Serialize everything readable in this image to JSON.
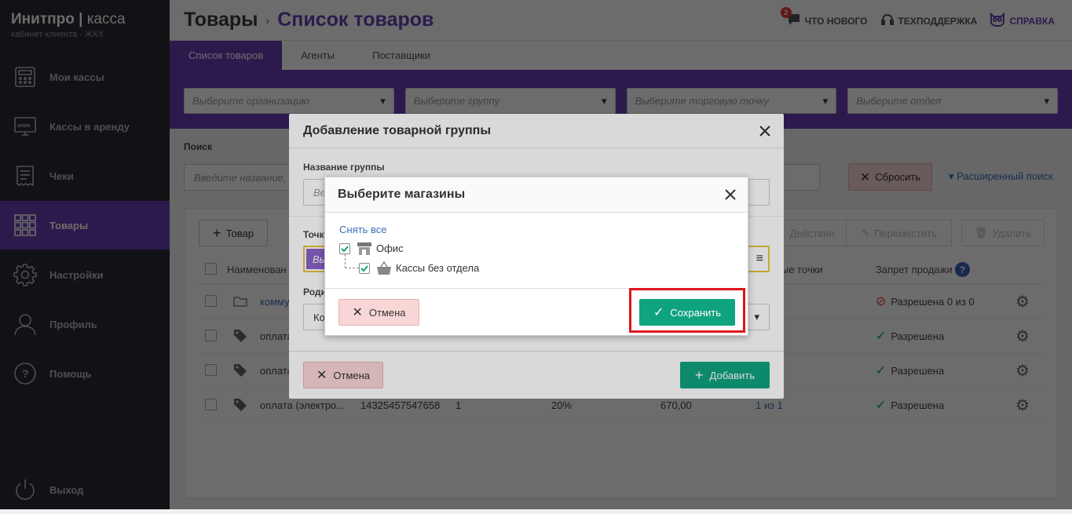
{
  "brand": {
    "title": "Инитпро",
    "title2": "касса",
    "subtitle": "кабинет клиента - ЖКХ"
  },
  "sidebar": {
    "items": [
      {
        "label": "Мои кассы"
      },
      {
        "label": "Кассы в аренду"
      },
      {
        "label": "Чеки"
      },
      {
        "label": "Товары"
      },
      {
        "label": "Настройки"
      },
      {
        "label": "Профиль"
      },
      {
        "label": "Помощь"
      }
    ],
    "logout": "Выход"
  },
  "header": {
    "crumb1": "Товары",
    "crumb2": "Список товаров",
    "badge": "2",
    "whats_new": "ЧТО НОВОГО",
    "support": "ТЕХПОДДЕРЖКА",
    "help": "СПРАВКА"
  },
  "tabs": [
    "Список товаров",
    "Агенты",
    "Поставщики"
  ],
  "filters": [
    "Выберите организацию",
    "Выберите группу",
    "Выберите торговую точку",
    "Выберите отдел"
  ],
  "search": {
    "label": "Поиск",
    "placeholder": "Введите название, ",
    "reset": "Сбросить",
    "advanced": "Расширенный поиск"
  },
  "toolbar": {
    "add_item": "Товар",
    "actions": "Действия",
    "move": "Переместить",
    "delete": "Удалить"
  },
  "table": {
    "headers": {
      "name": "Наименован",
      "points": "ые точки",
      "ban": "Запрет продажи"
    },
    "rows": [
      {
        "name": "комму",
        "barcode": "",
        "qty": "",
        "vat": "",
        "price": "",
        "points": "",
        "status": "Разрешена 0 из 0"
      },
      {
        "name": "оплата",
        "barcode": "",
        "qty": "",
        "vat": "",
        "price": "",
        "points": "",
        "status": "Разрешена"
      },
      {
        "name": "оплата",
        "barcode": "",
        "qty": "",
        "vat": "",
        "price": "",
        "points": "",
        "status": "Разрешена"
      },
      {
        "name": "оплата (электро...",
        "barcode": "14325457547658",
        "qty": "1",
        "vat": "20%",
        "price": "670,00",
        "points": "1 из 1",
        "status": "Разрешена"
      }
    ]
  },
  "modal_group": {
    "title": "Добавление товарной группы",
    "name_label": "Название группы",
    "name_placeholder": "Ве",
    "points_label": "Точк",
    "points_chip": "Вы",
    "parent_label": "Роди",
    "parent_value": "Ко",
    "cancel": "Отмена",
    "add": "Добавить"
  },
  "modal_shops": {
    "title": "Выберите магазины",
    "unselect_all": "Снять все",
    "tree": [
      {
        "label": "Офис",
        "checked": true
      },
      {
        "label": "Кассы без отдела",
        "checked": true
      }
    ],
    "cancel": "Отмена",
    "save": "Сохранить"
  },
  "colors": {
    "accent": "#6a3fb5",
    "sidebar": "#2b2d33",
    "success": "#10a37f",
    "danger_bg": "#f9d6d6",
    "highlight": "#e0141e"
  }
}
